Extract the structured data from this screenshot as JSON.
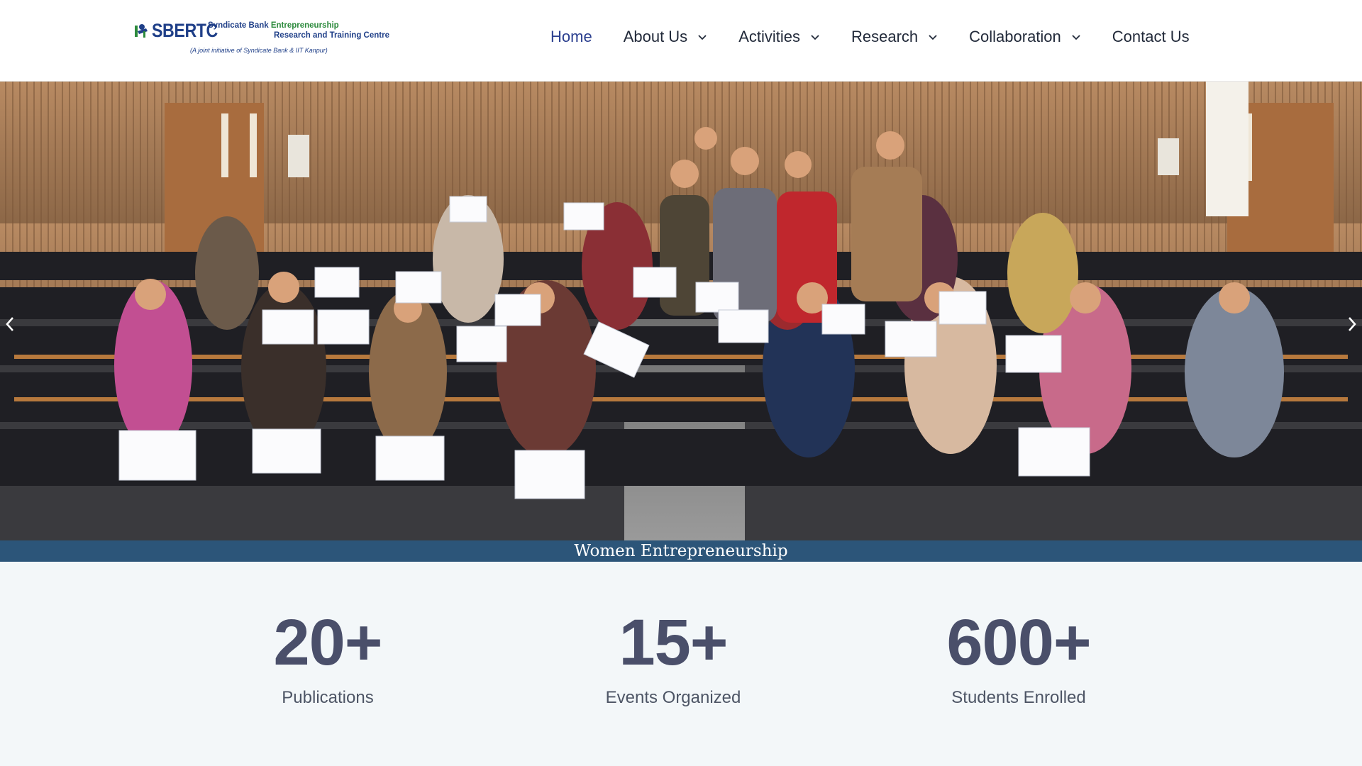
{
  "brand": {
    "acronym": "SBERTC",
    "line1_prefix": "Syndicate Bank ",
    "line1_highlight": "Entrepreneurship",
    "line2": "Research and Training Centre",
    "subtitle": "(A joint initiative of Syndicate Bank & IIT Kanpur)",
    "primary_color": "#1f3f88",
    "accent_color": "#2c8a3c"
  },
  "nav": {
    "items": [
      {
        "label": "Home",
        "active": true,
        "dropdown": false
      },
      {
        "label": "About Us",
        "active": false,
        "dropdown": true
      },
      {
        "label": "Activities",
        "active": false,
        "dropdown": true
      },
      {
        "label": "Research",
        "active": false,
        "dropdown": true
      },
      {
        "label": "Collaboration",
        "active": false,
        "dropdown": true
      },
      {
        "label": "Contact Us",
        "active": false,
        "dropdown": false
      }
    ],
    "dropdown_icon": "chevron-down-icon"
  },
  "hero": {
    "caption": "Women Entrepreneurship",
    "prev_icon": "chevron-left-icon",
    "next_icon": "chevron-right-icon",
    "caption_bar_color": "#2c5579"
  },
  "stats": [
    {
      "value": "20+",
      "label": "Publications"
    },
    {
      "value": "15+",
      "label": "Events Organized"
    },
    {
      "value": "600+",
      "label": "Students Enrolled"
    }
  ]
}
